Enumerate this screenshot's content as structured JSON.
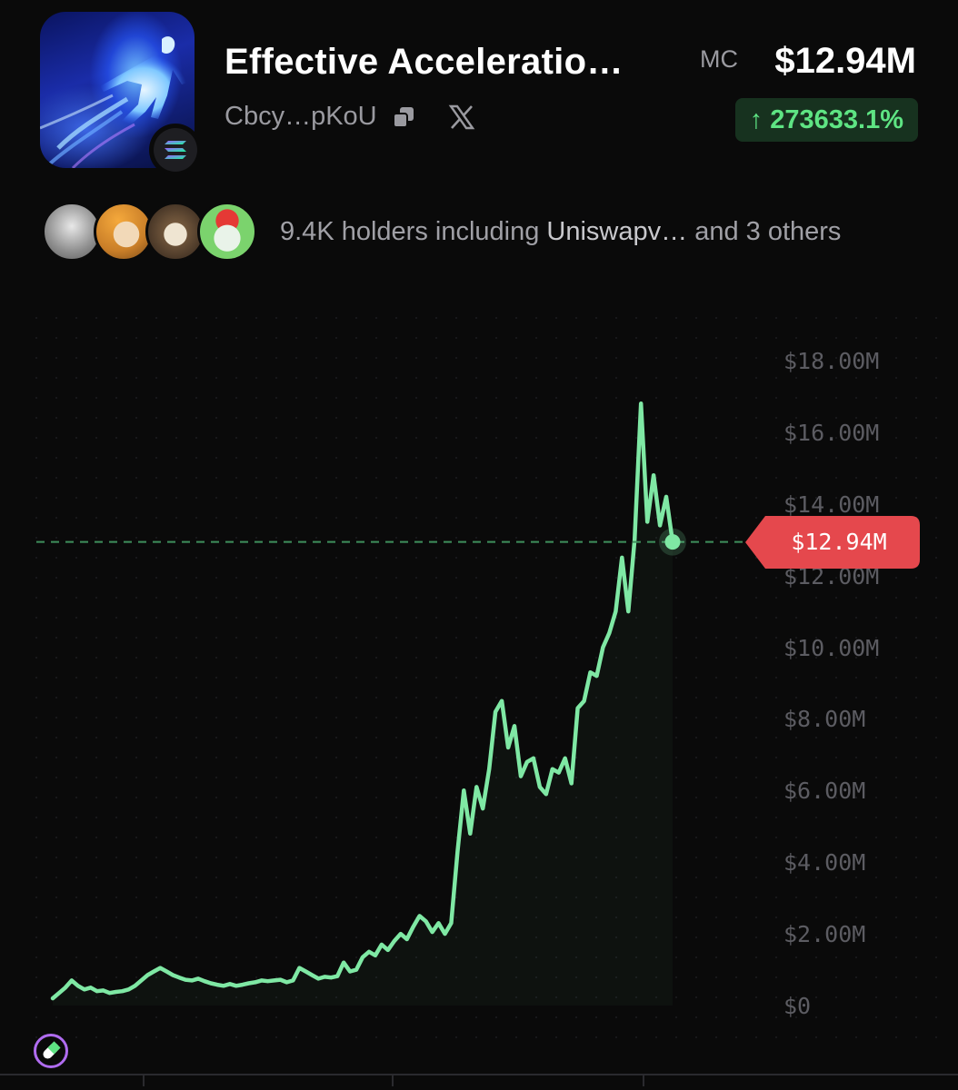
{
  "token": {
    "name": "Effective Acceleratio…",
    "address_short": "Cbcy…pKoU",
    "chain_icon": "solana-icon",
    "logo_icon": "glowing-figure-logo"
  },
  "market_cap": {
    "label": "MC",
    "value": "$12.94M",
    "change": "273633.1%",
    "change_arrow": "↑",
    "change_color": "#5ee483"
  },
  "holders": {
    "count_text": "9.4K holders including",
    "highlight": "Uniswapv…",
    "suffix": "and 3 others",
    "avatars": [
      "avatar-grey-mask",
      "avatar-blonde-anime",
      "avatar-goat",
      "avatar-christmas-frog"
    ]
  },
  "actions": {
    "copy_icon": "copy-icon",
    "x_icon": "x-social-icon",
    "pill_icon": "pill-icon"
  },
  "chart_data": {
    "type": "line",
    "title": "",
    "xlabel": "",
    "ylabel": "",
    "y_ticks": [
      "$18.00M",
      "$16.00M",
      "$14.00M",
      "$12.00M",
      "$10.00M",
      "$8.00M",
      "$6.00M",
      "$4.00M",
      "$2.00M",
      "$0"
    ],
    "ylim": [
      0,
      18
    ],
    "current_value_label": "$12.94M",
    "current_value": 12.94,
    "line_color": "#7fe8a4",
    "marker_color": "#e5484d",
    "grid": "dotted",
    "series": [
      {
        "name": "",
        "values": [
          0.2,
          0.35,
          0.5,
          0.7,
          0.55,
          0.45,
          0.5,
          0.4,
          0.42,
          0.35,
          0.38,
          0.4,
          0.45,
          0.55,
          0.7,
          0.85,
          0.95,
          1.05,
          0.95,
          0.85,
          0.78,
          0.72,
          0.7,
          0.75,
          0.68,
          0.62,
          0.58,
          0.55,
          0.6,
          0.55,
          0.58,
          0.62,
          0.65,
          0.7,
          0.68,
          0.7,
          0.72,
          0.65,
          0.7,
          1.05,
          0.95,
          0.85,
          0.75,
          0.8,
          0.78,
          0.82,
          1.2,
          0.95,
          1.0,
          1.35,
          1.5,
          1.4,
          1.7,
          1.55,
          1.8,
          2.0,
          1.85,
          2.2,
          2.5,
          2.35,
          2.05,
          2.3,
          2.0,
          2.3,
          4.3,
          6.0,
          4.8,
          6.1,
          5.5,
          6.6,
          8.2,
          8.5,
          7.2,
          7.8,
          6.4,
          6.8,
          6.9,
          6.1,
          5.9,
          6.6,
          6.5,
          6.9,
          6.2,
          8.3,
          8.5,
          9.3,
          9.2,
          10.0,
          10.4,
          11.0,
          12.5,
          11.0,
          13.0,
          16.8,
          13.5,
          14.8,
          13.4,
          14.2,
          12.94
        ]
      }
    ]
  }
}
